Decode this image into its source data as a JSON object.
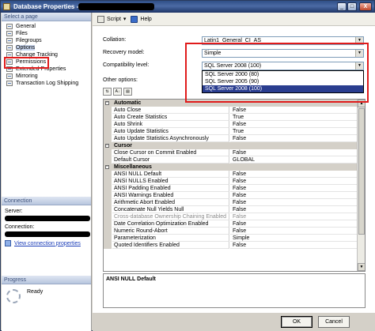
{
  "window": {
    "title": "Database Properties -",
    "min_glyph": "_",
    "max_glyph": "□",
    "close_glyph": "X"
  },
  "left": {
    "select_page_header": "Select a page",
    "pages": [
      {
        "label": "General"
      },
      {
        "label": "Files"
      },
      {
        "label": "Filegroups"
      },
      {
        "label": "Options"
      },
      {
        "label": "Change Tracking"
      },
      {
        "label": "Permissions"
      },
      {
        "label": "Extended Properties"
      },
      {
        "label": "Mirroring"
      },
      {
        "label": "Transaction Log Shipping"
      }
    ],
    "connection_header": "Connection",
    "server_label": "Server:",
    "connection_label": "Connection:",
    "view_connection_link": "View connection properties",
    "progress_header": "Progress",
    "progress_status": "Ready"
  },
  "toolbar": {
    "script_label": "Script",
    "script_arrow": "▾",
    "help_label": "Help"
  },
  "form": {
    "collation_label": "Collation:",
    "collation_value": "Latin1_General_CI_AS",
    "recovery_label": "Recovery model:",
    "recovery_value": "Simple",
    "compat_label": "Compatibility level:",
    "compat_value": "SQL Server 2008 (100)",
    "compat_options": [
      "SQL Server 2000 (80)",
      "SQL Server 2005 (90)",
      "SQL Server 2008 (100)"
    ],
    "other_options_label": "Other options:",
    "arrow_glyph": "▼"
  },
  "grid": {
    "sort_icon_a": "⇅",
    "sort_icon_b": "A↓",
    "pages_icon": "▤",
    "categories": [
      {
        "name": "Automatic",
        "rows": [
          {
            "name": "Auto Close",
            "value": "False"
          },
          {
            "name": "Auto Create Statistics",
            "value": "True"
          },
          {
            "name": "Auto Shrink",
            "value": "False"
          },
          {
            "name": "Auto Update Statistics",
            "value": "True"
          },
          {
            "name": "Auto Update Statistics Asynchronously",
            "value": "False"
          }
        ]
      },
      {
        "name": "Cursor",
        "rows": [
          {
            "name": "Close Cursor on Commit Enabled",
            "value": "False"
          },
          {
            "name": "Default Cursor",
            "value": "GLOBAL"
          }
        ]
      },
      {
        "name": "Miscellaneous",
        "rows": [
          {
            "name": "ANSI NULL Default",
            "value": "False"
          },
          {
            "name": "ANSI NULLS Enabled",
            "value": "False"
          },
          {
            "name": "ANSI Padding Enabled",
            "value": "False"
          },
          {
            "name": "ANSI Warnings Enabled",
            "value": "False"
          },
          {
            "name": "Arithmetic Abort Enabled",
            "value": "False"
          },
          {
            "name": "Concatenate Null Yields Null",
            "value": "False"
          },
          {
            "name": "Cross-database Ownership Chaining Enabled",
            "value": "False",
            "disabled": true
          },
          {
            "name": "Date Correlation Optimization Enabled",
            "value": "False"
          },
          {
            "name": "Numeric Round-Abort",
            "value": "False"
          },
          {
            "name": "Parameterization",
            "value": "Simple"
          },
          {
            "name": "Quoted Identifiers Enabled",
            "value": "False"
          }
        ]
      }
    ],
    "collapse_glyph": "−",
    "scroll_up": "▲",
    "scroll_down": "▼"
  },
  "description": {
    "title": "ANSI NULL Default"
  },
  "buttons": {
    "ok": "OK",
    "cancel": "Cancel"
  }
}
